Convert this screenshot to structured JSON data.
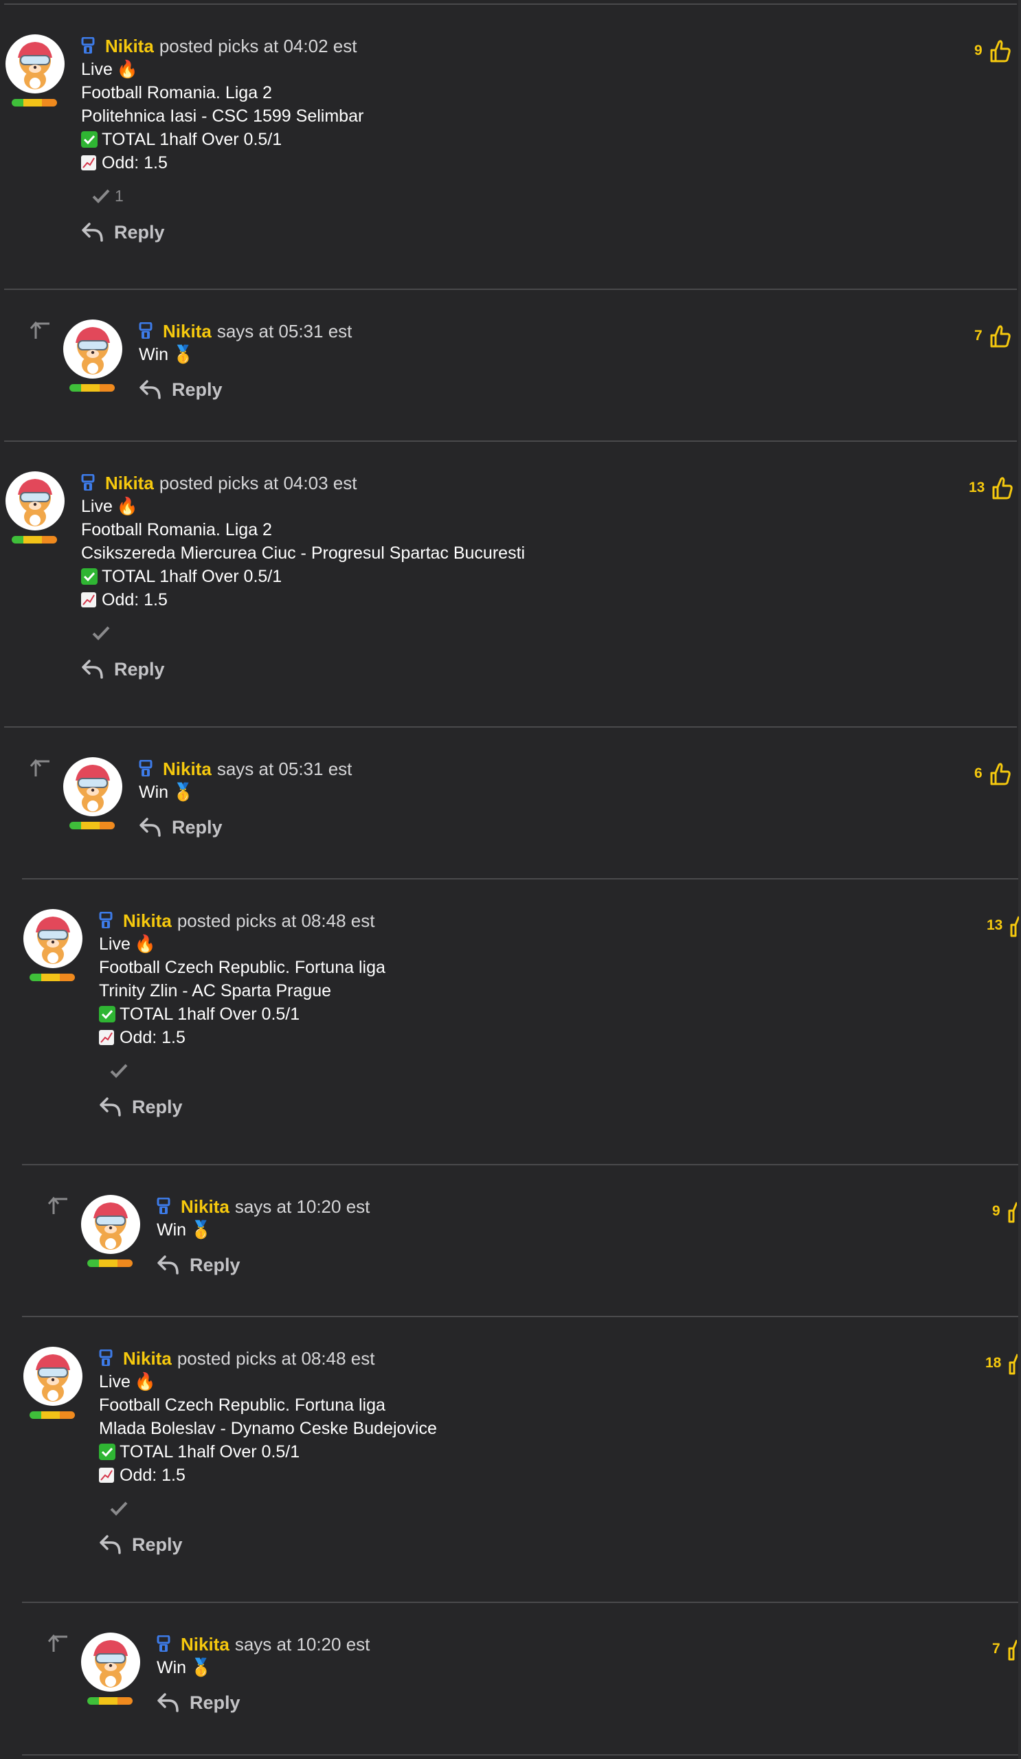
{
  "colors": {
    "background": "#262628",
    "author": "#f6c90e",
    "separator": "#4a4a4c",
    "reply": "#c3c3c6"
  },
  "icons": {
    "badge": "moderator-badge-icon",
    "like": "thumbs-up-icon",
    "reply": "reply-arrow-icon",
    "thread": "thread-up-arrow-icon",
    "approve": "checkmark-icon"
  },
  "comments": [
    {
      "author": "Nikita",
      "meta": "posted picks at 04:02 est",
      "lines": [
        "Live",
        "Football Romania. Liga 2",
        "Politehnica Iasi - CSC 1599 Selimbar",
        "TOTAL 1half Over 0.5/1",
        "Odd: 1.5"
      ],
      "approvals": "1",
      "likes": "9",
      "reply_label": "Reply"
    },
    {
      "author": "Nikita",
      "meta": "says at 05:31 est",
      "lines": [
        "Win"
      ],
      "likes": "7",
      "reply_label": "Reply"
    },
    {
      "author": "Nikita",
      "meta": "posted picks at 04:03 est",
      "lines": [
        "Live",
        "Football Romania. Liga 2",
        "Csikszereda Miercurea Ciuc - Progresul Spartac Bucuresti",
        "TOTAL 1half Over 0.5/1",
        "Odd: 1.5"
      ],
      "approvals": "",
      "likes": "13",
      "reply_label": "Reply"
    },
    {
      "author": "Nikita",
      "meta": "says at 05:31 est",
      "lines": [
        "Win"
      ],
      "likes": "6",
      "reply_label": "Reply"
    },
    {
      "author": "Nikita",
      "meta": "posted picks at 08:48 est",
      "lines": [
        "Live",
        "Football Czech Republic. Fortuna liga",
        "Trinity Zlin - AC Sparta Prague",
        "TOTAL 1half Over 0.5/1",
        "Odd: 1.5"
      ],
      "approvals": "",
      "likes": "13",
      "reply_label": "Reply"
    },
    {
      "author": "Nikita",
      "meta": "says at 10:20 est",
      "lines": [
        "Win"
      ],
      "likes": "9",
      "reply_label": "Reply"
    },
    {
      "author": "Nikita",
      "meta": "posted picks at 08:48 est",
      "lines": [
        "Live",
        "Football Czech Republic. Fortuna liga",
        "Mlada Boleslav - Dynamo Ceske Budejovice",
        "TOTAL 1half Over 0.5/1",
        "Odd: 1.5"
      ],
      "approvals": "",
      "likes": "18",
      "reply_label": "Reply"
    },
    {
      "author": "Nikita",
      "meta": "says at 10:20 est",
      "lines": [
        "Win"
      ],
      "likes": "7",
      "reply_label": "Reply"
    }
  ]
}
